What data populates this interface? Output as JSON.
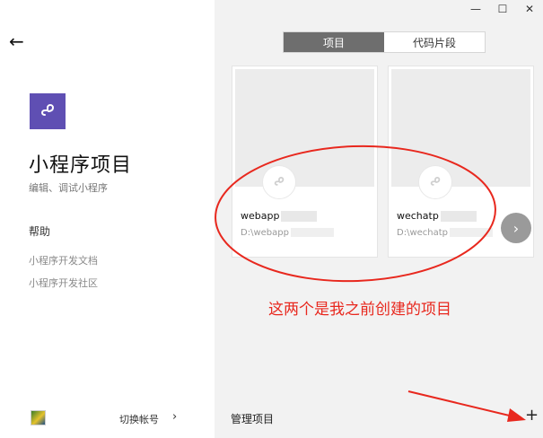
{
  "window": {
    "minimize": "—",
    "maximize": "☐",
    "close": "✕"
  },
  "left": {
    "back": "←",
    "title": "小程序项目",
    "subtitle": "编辑、调试小程序",
    "help_title": "帮助",
    "help_links": [
      "小程序开发文档",
      "小程序开发社区"
    ],
    "switch_account": "切换帐号",
    "switch_chevron": "›"
  },
  "right": {
    "tabs": [
      {
        "label": "项目",
        "active": true
      },
      {
        "label": "代码片段",
        "active": false
      }
    ],
    "projects": [
      {
        "name": "webapp",
        "path": "D:\\webapp"
      },
      {
        "name": "wechatp",
        "path": "D:\\wechatp"
      }
    ],
    "next": "›",
    "manage": "管理项目",
    "add": "+"
  },
  "annotation": {
    "text": "这两个是我之前创建的项目",
    "color": "#e8281e"
  },
  "colors": {
    "accent": "#5f4fb3",
    "tab_active": "#6e6e6e"
  }
}
